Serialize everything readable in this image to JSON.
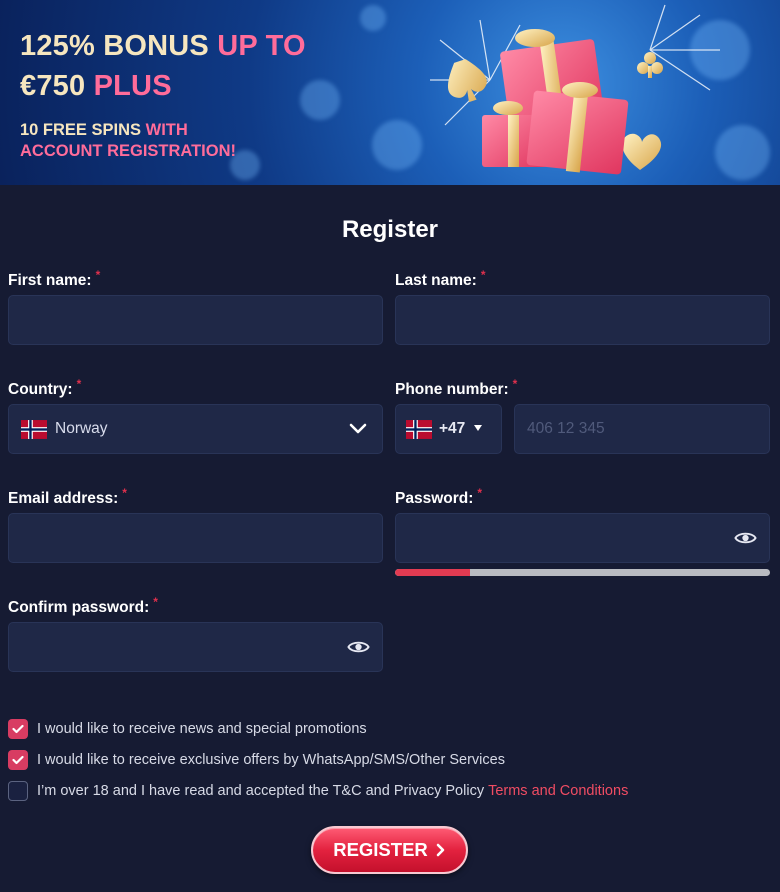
{
  "banner": {
    "line1_a": "125% BONUS",
    "line1_b": "UP TO",
    "line2_a": "€750",
    "line2_b": "PLUS",
    "sub1_a": "10 FREE SPINS",
    "sub1_b": "WITH",
    "sub2": "ACCOUNT REGISTRATION!"
  },
  "form": {
    "title": "Register",
    "required_mark": "*",
    "first_name": {
      "label": "First name:",
      "value": "",
      "placeholder": ""
    },
    "last_name": {
      "label": "Last name:",
      "value": "",
      "placeholder": ""
    },
    "country": {
      "label": "Country:",
      "value": "Norway",
      "flag": "norway-flag-icon"
    },
    "phone": {
      "label": "Phone number:",
      "dial_code": "+47",
      "value": "",
      "placeholder": "406 12 345",
      "flag": "norway-flag-icon"
    },
    "email": {
      "label": "Email address:",
      "value": "",
      "placeholder": ""
    },
    "password": {
      "label": "Password:",
      "value": "",
      "placeholder": "",
      "strength_fraction": 0.2
    },
    "confirm_password": {
      "label": "Confirm password:",
      "value": "",
      "placeholder": ""
    }
  },
  "consents": [
    {
      "text": "I would like to receive news and special promotions",
      "checked": true
    },
    {
      "text": "I would like to receive exclusive offers by WhatsApp/SMS/Other Services",
      "checked": true
    },
    {
      "text": "I’m over 18 and I have read and accepted the T&C and Privacy Policy",
      "link": "Terms and Conditions",
      "checked": false
    }
  ],
  "register_button": "REGISTER",
  "colors": {
    "background": "#161b33",
    "field": "#1f2847",
    "accent": "#e23b52",
    "banner_pink": "#ff6c9a",
    "banner_cream": "#f6e6bf"
  }
}
